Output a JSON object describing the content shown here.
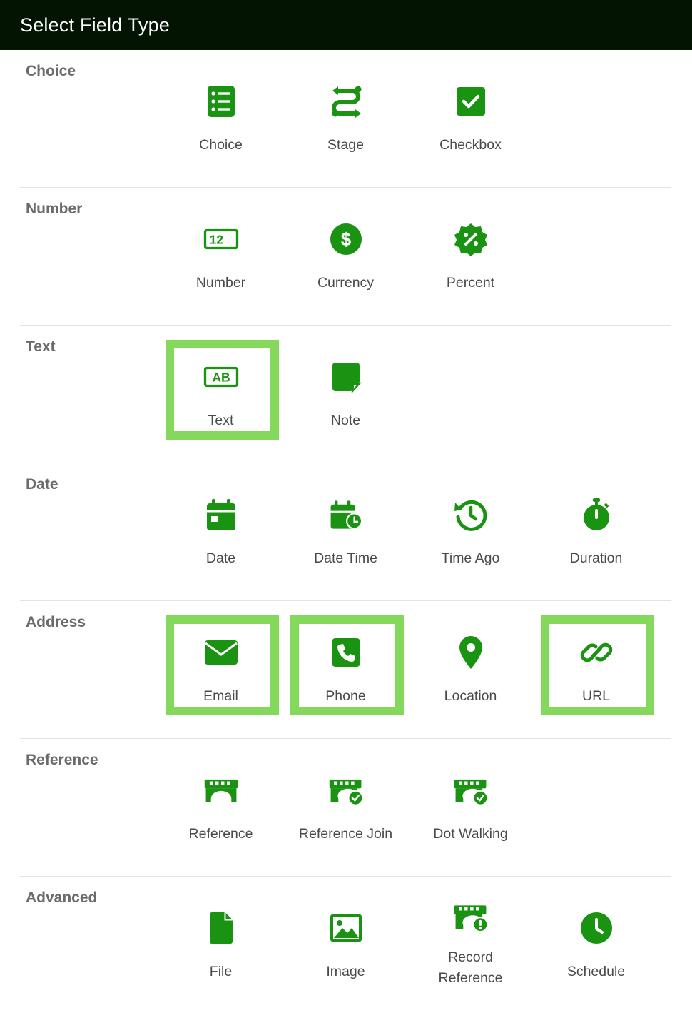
{
  "header": {
    "title": "Select Field Type"
  },
  "colors": {
    "header_bg": "#031402",
    "icon_green": "#1a9212",
    "highlight": "#84d85c"
  },
  "sections": [
    {
      "title": "Choice",
      "fields": [
        {
          "label": "Choice",
          "icon": "list-icon"
        },
        {
          "label": "Stage",
          "icon": "stage-route-icon"
        },
        {
          "label": "Checkbox",
          "icon": "checkbox-icon"
        }
      ]
    },
    {
      "title": "Number",
      "fields": [
        {
          "label": "Number",
          "icon": "number-12-icon",
          "glyph": "12"
        },
        {
          "label": "Currency",
          "icon": "dollar-icon"
        },
        {
          "label": "Percent",
          "icon": "percent-badge-icon"
        }
      ]
    },
    {
      "title": "Text",
      "fields": [
        {
          "label": "Text",
          "icon": "ab-text-icon",
          "glyph": "AB",
          "highlighted": true
        },
        {
          "label": "Note",
          "icon": "sticky-note-icon"
        }
      ]
    },
    {
      "title": "Date",
      "fields": [
        {
          "label": "Date",
          "icon": "calendar-icon"
        },
        {
          "label": "Date Time",
          "icon": "calendar-clock-icon"
        },
        {
          "label": "Time Ago",
          "icon": "history-icon"
        },
        {
          "label": "Duration",
          "icon": "stopwatch-icon"
        }
      ]
    },
    {
      "title": "Address",
      "fields": [
        {
          "label": "Email",
          "icon": "envelope-icon",
          "highlighted": true
        },
        {
          "label": "Phone",
          "icon": "phone-icon",
          "highlighted": true
        },
        {
          "label": "Location",
          "icon": "map-pin-icon"
        },
        {
          "label": "URL",
          "icon": "link-icon",
          "highlighted": true
        }
      ]
    },
    {
      "title": "Reference",
      "fields": [
        {
          "label": "Reference",
          "icon": "bridge-icon"
        },
        {
          "label": "Reference Join",
          "icon": "bridge-check-icon"
        },
        {
          "label": "Dot Walking",
          "icon": "bridge-check-icon"
        }
      ]
    },
    {
      "title": "Advanced",
      "fields": [
        {
          "label": "File",
          "icon": "file-icon"
        },
        {
          "label": "Image",
          "icon": "image-icon"
        },
        {
          "label": "Record Reference",
          "icon": "bridge-alert-icon"
        },
        {
          "label": "Schedule",
          "icon": "clock-icon"
        }
      ]
    }
  ]
}
